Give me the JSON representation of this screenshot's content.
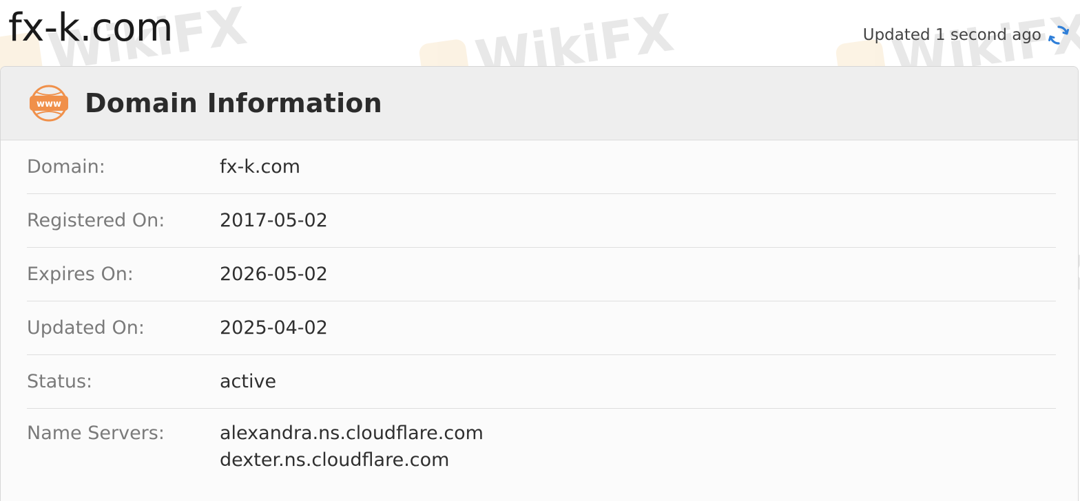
{
  "page": {
    "title": "fx-k.com",
    "updated_text": "Updated 1 second ago"
  },
  "card": {
    "title": "Domain Information",
    "icon_label": "www"
  },
  "rows": [
    {
      "label": "Domain:",
      "value": "fx-k.com"
    },
    {
      "label": "Registered On:",
      "value": "2017-05-02"
    },
    {
      "label": "Expires On:",
      "value": "2026-05-02"
    },
    {
      "label": "Updated On:",
      "value": "2025-04-02"
    },
    {
      "label": "Status:",
      "value": "active"
    },
    {
      "label": "Name Servers:",
      "values": [
        "alexandra.ns.cloudflare.com",
        "dexter.ns.cloudflare.com"
      ]
    }
  ],
  "watermark": {
    "text": "WikiFX"
  },
  "colors": {
    "refresh_icon": "#2f7fd8",
    "www_icon": "#f0904a",
    "watermark_logo": "#e8a030"
  }
}
